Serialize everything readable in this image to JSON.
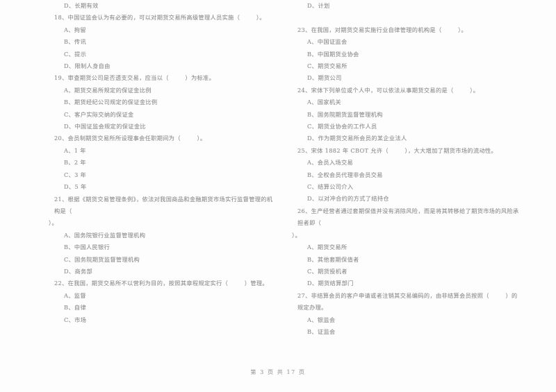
{
  "document": {
    "type": "scanned-exam-paper",
    "text_color": "#8d8d8d",
    "background_color": "#ffffff"
  },
  "columns": {
    "left": {
      "blocks": [
        {
          "name": "orphan-option-d",
          "lines": [
            {
              "kind": "option",
              "text": "D、长期有效"
            }
          ]
        },
        {
          "name": "question-18",
          "lines": [
            {
              "kind": "question",
              "text": "18、中国证监会认为有必要的，可以对期货交易所高级管理人员实施（        ）。"
            },
            {
              "kind": "option",
              "text": "A、拘留"
            },
            {
              "kind": "option",
              "text": "B、传讯"
            },
            {
              "kind": "option",
              "text": "C、提示"
            },
            {
              "kind": "option",
              "text": "D、限制人身自由"
            }
          ]
        },
        {
          "name": "question-19",
          "lines": [
            {
              "kind": "question",
              "text": "19、审查期货公司是否透支交易，应当以（        ）为标准。"
            },
            {
              "kind": "option",
              "text": "A、期货交易所规定的保证金比例"
            },
            {
              "kind": "option",
              "text": "B、期货经纪公司规定的保证金比例"
            },
            {
              "kind": "option",
              "text": "C、客户实际交纳的保证金"
            },
            {
              "kind": "option",
              "text": "D、中国证监会规定的保证金比"
            }
          ]
        },
        {
          "name": "question-20",
          "lines": [
            {
              "kind": "question",
              "text": "20、会员制期货交易所所设理事会任职期间为（        ）。"
            },
            {
              "kind": "option",
              "text": "A、1 年"
            },
            {
              "kind": "option",
              "text": "B、2 年"
            },
            {
              "kind": "option",
              "text": "C、3 年"
            },
            {
              "kind": "option",
              "text": "D、5 年"
            }
          ]
        },
        {
          "name": "question-21",
          "lines": [
            {
              "kind": "question",
              "text": "21、根据《期货交易管理条例》，依法对我国商品和金融期货市场实行监督管理的机构是（"
            },
            {
              "kind": "question-cont",
              "text": "）。"
            },
            {
              "kind": "option",
              "text": "A、国务院银行业监督管理机构"
            },
            {
              "kind": "option",
              "text": "B、中国人民银行"
            },
            {
              "kind": "option",
              "text": "C、国务院期货监督管理机构"
            },
            {
              "kind": "option",
              "text": "D、商务部"
            }
          ]
        },
        {
          "name": "question-22",
          "lines": [
            {
              "kind": "question",
              "text": "22、在我国，期货交易所不以营利为目的，按照其章程规定实行（        ）管理。"
            },
            {
              "kind": "option",
              "text": "A、监督"
            },
            {
              "kind": "option",
              "text": "B、自律"
            },
            {
              "kind": "option",
              "text": "C、市场"
            }
          ]
        }
      ]
    },
    "right": {
      "blocks": [
        {
          "name": "orphan-option-d",
          "lines": [
            {
              "kind": "option",
              "text": "D、计划"
            }
          ]
        },
        {
          "name": "gap",
          "lines": [
            {
              "kind": "spacer",
              "text": ""
            }
          ]
        },
        {
          "name": "question-23",
          "lines": [
            {
              "kind": "question",
              "text": "23、在我国，对期货交易实施行业自律管理的机构是（        ）。"
            },
            {
              "kind": "option",
              "text": "A、中国证监会"
            },
            {
              "kind": "option",
              "text": "B、中国期货业协会"
            },
            {
              "kind": "option",
              "text": "C、期货交易所"
            },
            {
              "kind": "option",
              "text": "D、期货公司"
            }
          ]
        },
        {
          "name": "question-24",
          "lines": [
            {
              "kind": "question",
              "text": "24、宋体下列单位或个人中，可以依法从事期货交易的是（        ）。"
            },
            {
              "kind": "option",
              "text": "A、国家机关"
            },
            {
              "kind": "option",
              "text": "B、国务院期货监督管理机构"
            },
            {
              "kind": "option",
              "text": "C、期货业协会的工作人员"
            },
            {
              "kind": "option",
              "text": "D、作为期货交易所会员的某企业法人"
            }
          ]
        },
        {
          "name": "question-25",
          "lines": [
            {
              "kind": "question",
              "text": "25、宋体 1882 年 CBOT 允许（        ），大大增加了期货市场的流动性。"
            },
            {
              "kind": "option",
              "text": "A、会员入场交易"
            },
            {
              "kind": "option",
              "text": "B、全权会员代理非会员交易"
            },
            {
              "kind": "option",
              "text": "C、结算公司介入"
            },
            {
              "kind": "option",
              "text": "D、以对冲合约的方式了结持仓"
            }
          ]
        },
        {
          "name": "question-26",
          "lines": [
            {
              "kind": "question",
              "text": "26、生产经营者通过套期保值并没有消除风险，而是将其转移给了期货市场的风险承担者即（"
            },
            {
              "kind": "question-cont",
              "text": "）。"
            },
            {
              "kind": "option",
              "text": "A、期货交易所"
            },
            {
              "kind": "option",
              "text": "B、其他套期保值者"
            },
            {
              "kind": "option",
              "text": "C、期货投机者"
            },
            {
              "kind": "option",
              "text": "D、期货结算部门"
            }
          ]
        },
        {
          "name": "question-27",
          "lines": [
            {
              "kind": "question",
              "text": "27、非结算会员的客户申请或者注销其交易编码的，由非结算会员按照（        ）的规定办理。"
            },
            {
              "kind": "option",
              "text": "A、银监会"
            },
            {
              "kind": "option",
              "text": "B、证监会"
            }
          ]
        }
      ]
    }
  },
  "footer": {
    "page_label": "第 3 页 共 17 页",
    "current_page": 3,
    "total_pages": 17
  }
}
